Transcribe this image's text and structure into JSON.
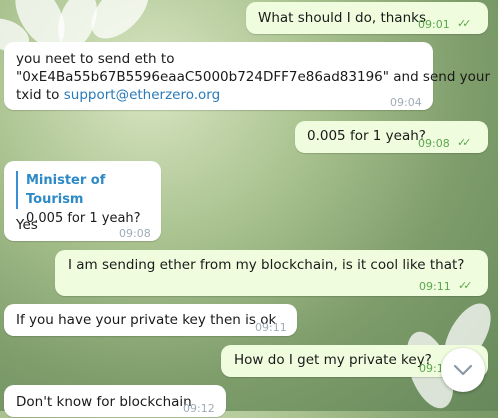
{
  "messages": [
    {
      "text": "What should I do, thanks",
      "time": "09:01"
    },
    {
      "text_line1": "you neet to send eth to",
      "text_line2": "\"0xE4Ba55b67B5596eaaC5000b724DFF7e86ad83196\" and send your",
      "text_line3_prefix": "txid to ",
      "link": "support@etherzero.org",
      "time": "09:04"
    },
    {
      "text": "0.005 for 1 yeah?",
      "time": "09:08"
    },
    {
      "quote_author": "Minister of Tourism",
      "quote_text": "0.005 for 1 yeah?",
      "text": "Yes",
      "time": "09:08"
    },
    {
      "text": "I am sending ether from my blockchain, is it cool like that?",
      "time": "09:11"
    },
    {
      "text": "If you have your private key then is ok",
      "time": "09:11"
    },
    {
      "text": "How do I get my private key?",
      "time": "09:1"
    },
    {
      "text": "Don't know for blockchain",
      "time": "09:12"
    }
  ],
  "icons": {
    "read_checks": "double-check-icon",
    "scroll_down": "chevron-down-icon"
  }
}
